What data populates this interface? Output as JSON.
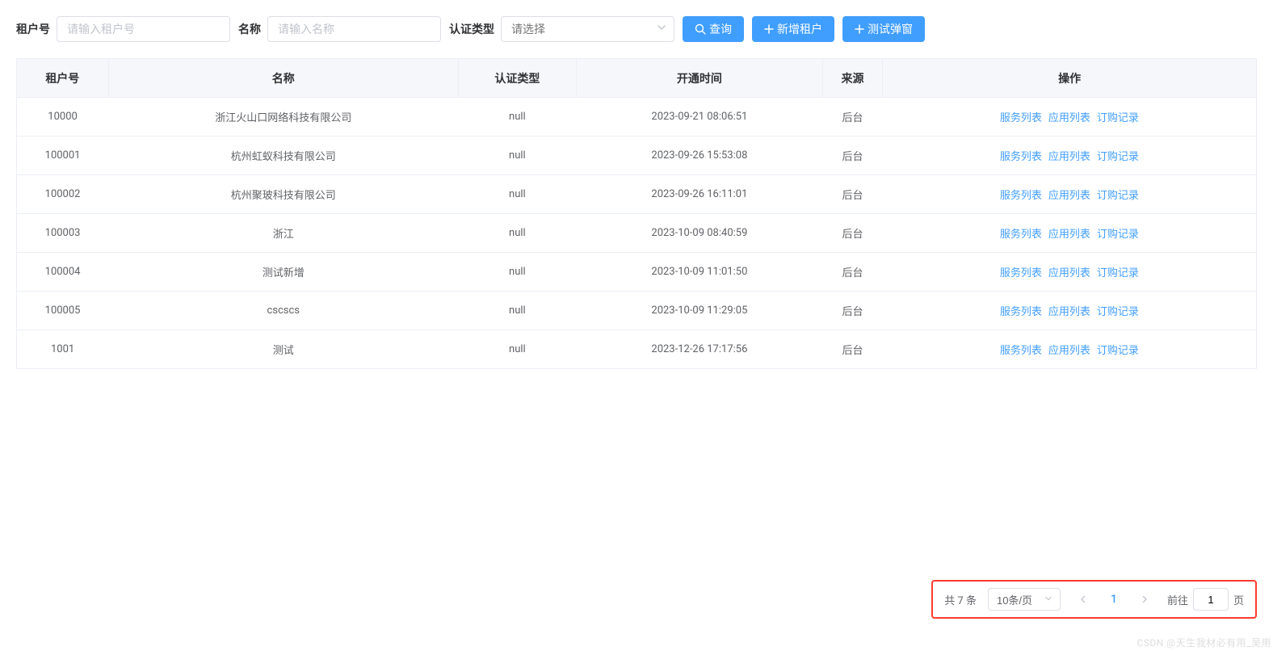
{
  "filters": {
    "tenant_label": "租户号",
    "tenant_placeholder": "请输入租户号",
    "name_label": "名称",
    "name_placeholder": "请输入名称",
    "auth_label": "认证类型",
    "auth_placeholder": "请选择"
  },
  "buttons": {
    "search": "查询",
    "add": "新增租户",
    "test": "测试弹窗"
  },
  "table": {
    "headers": {
      "tenant": "租户号",
      "name": "名称",
      "auth": "认证类型",
      "open_time": "开通时间",
      "source": "来源",
      "action": "操作"
    },
    "action_links": {
      "service": "服务列表",
      "app": "应用列表",
      "order": "订购记录"
    },
    "rows": [
      {
        "tenant": "10000",
        "name": "浙江火山口网络科技有限公司",
        "auth": "null",
        "open_time": "2023-09-21 08:06:51",
        "source": "后台"
      },
      {
        "tenant": "100001",
        "name": "杭州虹蚁科技有限公司",
        "auth": "null",
        "open_time": "2023-09-26 15:53:08",
        "source": "后台"
      },
      {
        "tenant": "100002",
        "name": "杭州聚玻科技有限公司",
        "auth": "null",
        "open_time": "2023-09-26 16:11:01",
        "source": "后台"
      },
      {
        "tenant": "100003",
        "name": "浙江",
        "auth": "null",
        "open_time": "2023-10-09 08:40:59",
        "source": "后台"
      },
      {
        "tenant": "100004",
        "name": "测试新增",
        "auth": "null",
        "open_time": "2023-10-09 11:01:50",
        "source": "后台"
      },
      {
        "tenant": "100005",
        "name": "cscscs",
        "auth": "null",
        "open_time": "2023-10-09 11:29:05",
        "source": "后台"
      },
      {
        "tenant": "1001",
        "name": "测试",
        "auth": "null",
        "open_time": "2023-12-26 17:17:56",
        "source": "后台"
      }
    ]
  },
  "pagination": {
    "total_text": "共 7 条",
    "page_size": "10条/页",
    "current_page": "1",
    "goto_prefix": "前往",
    "goto_value": "1",
    "goto_suffix": "页"
  },
  "watermark": "CSDN @天生我材必有用_吴用"
}
